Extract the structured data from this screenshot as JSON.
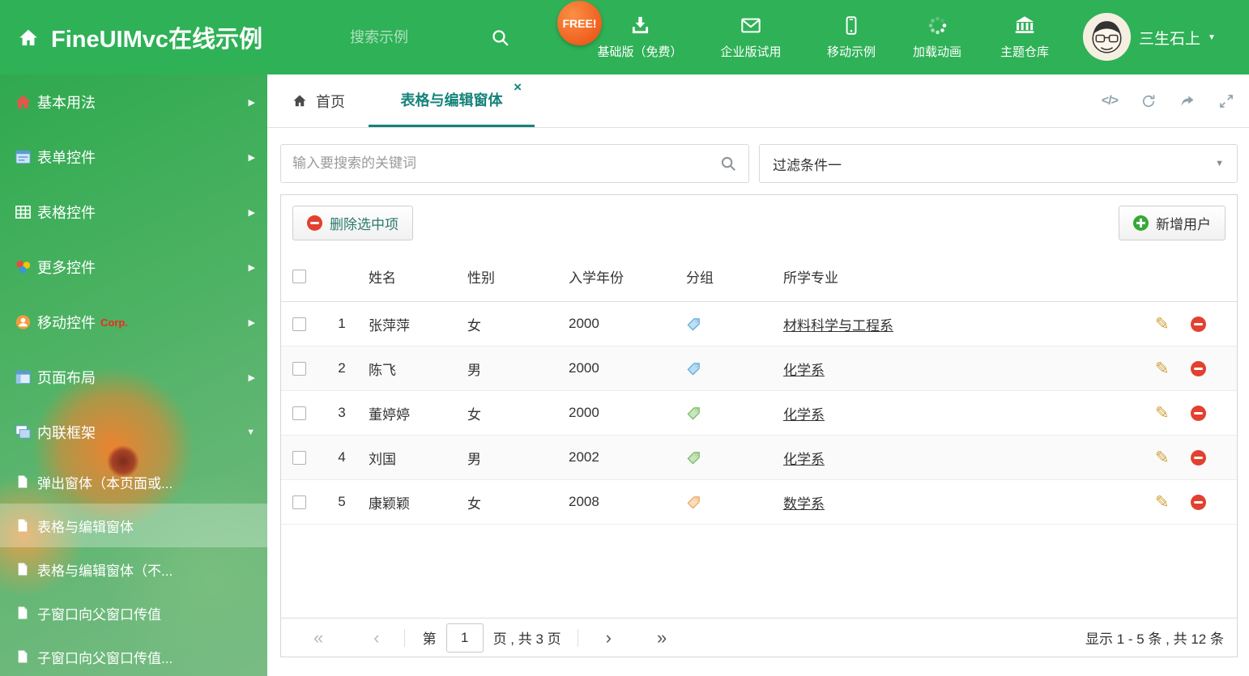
{
  "header": {
    "title": "FineUIMvc在线示例",
    "search_placeholder": "搜索示例",
    "free_badge": "FREE!",
    "nav_items": [
      {
        "label": "基础版（免费）",
        "icon": "download-icon"
      },
      {
        "label": "企业版试用",
        "icon": "envelope-icon"
      },
      {
        "label": "移动示例",
        "icon": "mobile-icon"
      },
      {
        "label": "加载动画",
        "icon": "spinner-icon"
      },
      {
        "label": "主题仓库",
        "icon": "bank-icon"
      }
    ],
    "user": {
      "name": "三生石上"
    }
  },
  "sidebar": {
    "items": [
      {
        "label": "基本用法",
        "icon": "home-icon"
      },
      {
        "label": "表单控件",
        "icon": "form-icon"
      },
      {
        "label": "表格控件",
        "icon": "table-icon"
      },
      {
        "label": "更多控件",
        "icon": "more-controls-icon"
      },
      {
        "label": "移动控件",
        "badge": "Corp.",
        "icon": "mobile-controls-icon"
      },
      {
        "label": "页面布局",
        "icon": "layout-icon"
      },
      {
        "label": "内联框架",
        "icon": "frames-icon",
        "expanded": true,
        "children": [
          {
            "label": "弹出窗体（本页面或..."
          },
          {
            "label": "表格与编辑窗体",
            "active": true
          },
          {
            "label": "表格与编辑窗体（不..."
          },
          {
            "label": "子窗口向父窗口传值"
          },
          {
            "label": "子窗口向父窗口传值..."
          }
        ]
      }
    ]
  },
  "tabs": [
    {
      "label": "首页"
    },
    {
      "label": "表格与编辑窗体",
      "active": true,
      "closable": true
    }
  ],
  "filter": {
    "search_placeholder": "输入要搜索的关键词",
    "dropdown_value": "过滤条件一"
  },
  "grid": {
    "delete_button": "删除选中项",
    "add_button": "新增用户",
    "columns": [
      "姓名",
      "性别",
      "入学年份",
      "分组",
      "所学专业"
    ],
    "rows": [
      {
        "num": 1,
        "name": "张萍萍",
        "gender": "女",
        "year": "2000",
        "tag_color": "#64aede",
        "major": "材料科学与工程系"
      },
      {
        "num": 2,
        "name": "陈飞",
        "gender": "男",
        "year": "2000",
        "tag_color": "#64aede",
        "major": "化学系"
      },
      {
        "num": 3,
        "name": "董婷婷",
        "gender": "女",
        "year": "2000",
        "tag_color": "#7dbd65",
        "major": "化学系"
      },
      {
        "num": 4,
        "name": "刘国",
        "gender": "男",
        "year": "2002",
        "tag_color": "#7dbd65",
        "major": "化学系"
      },
      {
        "num": 5,
        "name": "康颖颖",
        "gender": "女",
        "year": "2008",
        "tag_color": "#efa963",
        "major": "数学系"
      }
    ]
  },
  "pagination": {
    "page_prefix": "第",
    "current_page": "1",
    "page_suffix": "页 , 共 3 页",
    "summary": "显示 1 - 5 条 , 共 12 条"
  },
  "icons": {
    "close": "×",
    "caret_down": "▼",
    "chevron_right": "▶",
    "chevron_down": "▼",
    "code": "</>",
    "pencil": "✎",
    "page_first": "«",
    "page_prev": "‹",
    "page_next": "›",
    "page_last": "»"
  },
  "colors": {
    "header_green": "#2fb157",
    "active_teal": "#15837a",
    "free_badge_orange": "#ee5c1c",
    "corp_red": "#f5281c"
  }
}
